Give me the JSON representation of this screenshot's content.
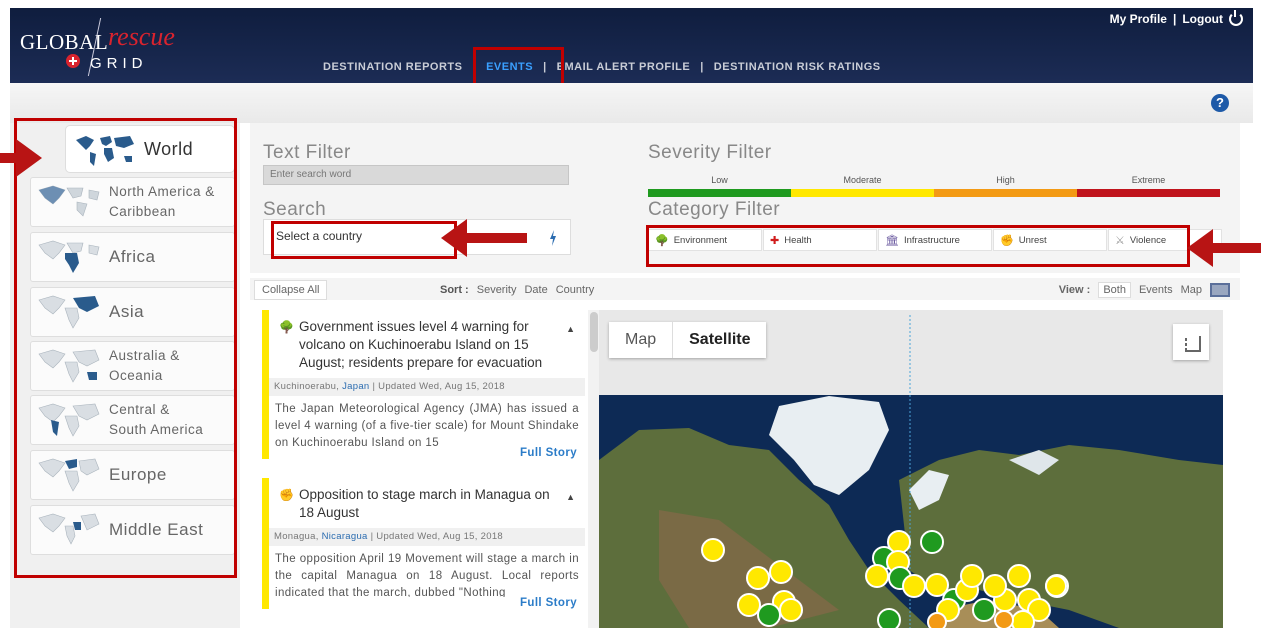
{
  "header": {
    "logo": {
      "global": "GLOBAL",
      "rescue": "rescue",
      "grid": "GRID"
    },
    "nav": [
      "DESTINATION REPORTS",
      "EVENTS",
      "EMAIL ALERT PROFILE",
      "DESTINATION RISK RATINGS"
    ],
    "nav_separator": "|",
    "active_nav": "EVENTS",
    "my_profile": "My Profile",
    "user_separator": "|",
    "logout": "Logout"
  },
  "help": "?",
  "regions": [
    {
      "label": "World",
      "icon": "world-map-icon",
      "selected": true
    },
    {
      "label": "North America & Caribbean",
      "line1": "North America &",
      "line2": "Caribbean",
      "icon": "north-america-map-icon"
    },
    {
      "label": "Africa",
      "icon": "africa-map-icon"
    },
    {
      "label": "Asia",
      "icon": "asia-map-icon"
    },
    {
      "label": "Australia & Oceania",
      "line1": "Australia &",
      "line2": "Oceania",
      "icon": "oceania-map-icon"
    },
    {
      "label": "Central & South America",
      "line1": "Central &",
      "line2": "South America",
      "icon": "south-america-map-icon"
    },
    {
      "label": "Europe",
      "icon": "europe-map-icon"
    },
    {
      "label": "Middle East",
      "icon": "middle-east-map-icon"
    }
  ],
  "filters": {
    "text_filter_title": "Text Filter",
    "search_placeholder": "Enter search word",
    "search_title": "Search",
    "country_placeholder": "Select a country",
    "severity_title": "Severity Filter",
    "severity": [
      {
        "label": "Low",
        "color": "#1f9a1f"
      },
      {
        "label": "Moderate",
        "color": "#ffe800"
      },
      {
        "label": "High",
        "color": "#f39a14"
      },
      {
        "label": "Extreme",
        "color": "#c0141c"
      }
    ],
    "category_title": "Category Filter",
    "categories": [
      {
        "label": "Environment",
        "icon": "tree-icon",
        "glyph": "🌳"
      },
      {
        "label": "Health",
        "icon": "red-cross-icon",
        "glyph": "✚"
      },
      {
        "label": "Infrastructure",
        "icon": "building-icon",
        "glyph": "🏛"
      },
      {
        "label": "Unrest",
        "icon": "fist-icon",
        "glyph": "✊"
      },
      {
        "label": "Violence",
        "icon": "swords-icon",
        "glyph": "⚔"
      }
    ]
  },
  "toolbar": {
    "collapse": "Collapse All",
    "sort_label": "Sort :",
    "sort_options": [
      "Severity",
      "Date",
      "Country"
    ],
    "view_label": "View :",
    "view_options": [
      "Both",
      "Events",
      "Map"
    ],
    "active_view": "Both"
  },
  "events": [
    {
      "title": "Government issues level 4 warning for volcano on Kuchinoerabu Island on 15 August; residents prepare for evacuation",
      "category": "Environment",
      "place": "Kuchinoerabu,",
      "country": "Japan",
      "updated": "| Updated Wed, Aug 15, 2018",
      "body": "The Japan Meteorological Agency (JMA) has issued a level 4 warning (of a five-tier scale) for Mount Shindake on Kuchinoerabu Island on 15",
      "more": "Full Story"
    },
    {
      "title": "Opposition to stage march in Managua on 18 August",
      "category": "Unrest",
      "place": "Monagua,",
      "country": "Nicaragua",
      "updated": "| Updated Wed, Aug 15, 2018",
      "body": "The opposition April 19 Movement will stage a march in the capital Managua on 18 August. Local reports indicated that the march, dubbed \"Nothing",
      "more": "Full Story"
    }
  ],
  "map": {
    "type_options": [
      "Map",
      "Satellite"
    ],
    "active_type": "Satellite",
    "fullscreen_label": "Toggle fullscreen view",
    "colors": {
      "ocean": "#0d2a55",
      "land": "#5d6e3c",
      "ice": "#e8eef2",
      "marker_low": "#1f9a1f",
      "marker_moderate": "#ffe800",
      "marker_high": "#f39a14"
    }
  }
}
